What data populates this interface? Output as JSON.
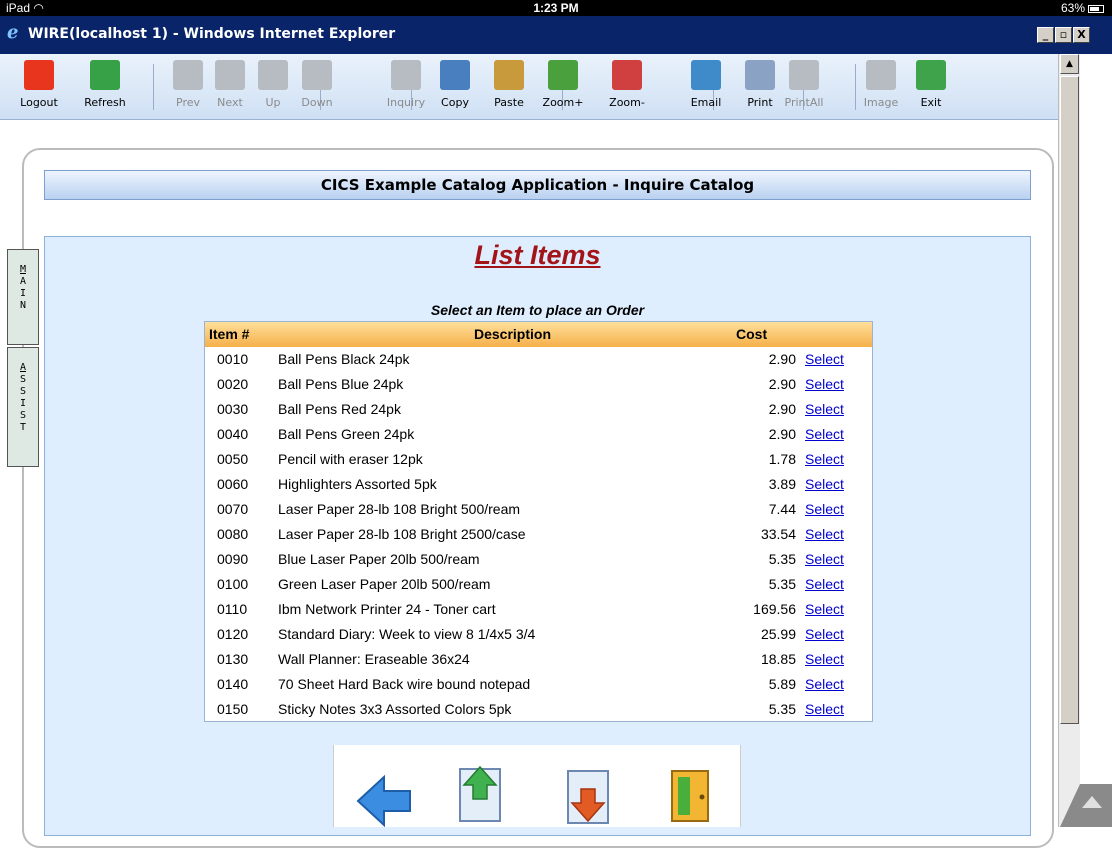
{
  "status_bar": {
    "device": "iPad",
    "wifi": "◠",
    "time": "1:23 PM",
    "battery": "63%"
  },
  "window": {
    "title": "WIRE(localhost 1) - Windows Internet Explorer",
    "min": "_",
    "max": "▫",
    "close": "X"
  },
  "toolbar": {
    "buttons": [
      {
        "label": "Logout",
        "icon": "logout-icon",
        "color": "#e8361e",
        "enabled": true
      },
      {
        "label": "Refresh",
        "icon": "refresh-icon",
        "color": "#36a146",
        "enabled": true
      },
      {
        "label": "Prev",
        "icon": "arrow-left-icon",
        "color": "#b7bcc3",
        "enabled": false
      },
      {
        "label": "Next",
        "icon": "arrow-right-icon",
        "color": "#b7bcc3",
        "enabled": false
      },
      {
        "label": "Up",
        "icon": "arrow-up-icon",
        "color": "#b7bcc3",
        "enabled": false
      },
      {
        "label": "Down",
        "icon": "arrow-down-icon",
        "color": "#b7bcc3",
        "enabled": false
      },
      {
        "label": "Inquiry",
        "icon": "inquiry-icon",
        "color": "#b7bcc3",
        "enabled": false
      },
      {
        "label": "Copy",
        "icon": "copy-icon",
        "color": "#4a7fbf",
        "enabled": true
      },
      {
        "label": "Paste",
        "icon": "paste-icon",
        "color": "#c89a3c",
        "enabled": true
      },
      {
        "label": "Zoom+",
        "icon": "zoom-in-icon",
        "color": "#4aa03c",
        "enabled": true
      },
      {
        "label": "Zoom-",
        "icon": "zoom-out-icon",
        "color": "#d04040",
        "enabled": true
      },
      {
        "label": "Email",
        "icon": "email-icon",
        "color": "#3f8ac9",
        "enabled": true
      },
      {
        "label": "Print",
        "icon": "print-icon",
        "color": "#8aa3c4",
        "enabled": true
      },
      {
        "label": "PrintAll",
        "icon": "print-all-icon",
        "color": "#b7bcc3",
        "enabled": false
      },
      {
        "label": "Image",
        "icon": "image-icon",
        "color": "#b7bcc3",
        "enabled": false
      },
      {
        "label": "Exit",
        "icon": "exit-icon",
        "color": "#3ea34a",
        "enabled": true
      }
    ]
  },
  "page": {
    "header": "CICS Example Catalog Application - Inquire Catalog",
    "title": "List Items",
    "subtitle": "Select an Item to place an Order"
  },
  "table": {
    "columns": {
      "item": "Item #",
      "description": "Description",
      "cost": "Cost"
    },
    "rows": [
      {
        "item": "0010",
        "description": "Ball Pens Black 24pk",
        "cost": "2.90",
        "action": "Select"
      },
      {
        "item": "0020",
        "description": "Ball Pens Blue 24pk",
        "cost": "2.90",
        "action": "Select"
      },
      {
        "item": "0030",
        "description": "Ball Pens Red 24pk",
        "cost": "2.90",
        "action": "Select"
      },
      {
        "item": "0040",
        "description": "Ball Pens Green 24pk",
        "cost": "2.90",
        "action": "Select"
      },
      {
        "item": "0050",
        "description": "Pencil with eraser 12pk",
        "cost": "1.78",
        "action": "Select"
      },
      {
        "item": "0060",
        "description": "Highlighters Assorted 5pk",
        "cost": "3.89",
        "action": "Select"
      },
      {
        "item": "0070",
        "description": "Laser Paper 28-lb 108 Bright 500/ream",
        "cost": "7.44",
        "action": "Select"
      },
      {
        "item": "0080",
        "description": "Laser Paper 28-lb 108 Bright 2500/case",
        "cost": "33.54",
        "action": "Select"
      },
      {
        "item": "0090",
        "description": "Blue Laser Paper 20lb 500/ream",
        "cost": "5.35",
        "action": "Select"
      },
      {
        "item": "0100",
        "description": "Green Laser Paper 20lb 500/ream",
        "cost": "5.35",
        "action": "Select"
      },
      {
        "item": "0110",
        "description": "Ibm Network Printer 24 - Toner cart",
        "cost": "169.56",
        "action": "Select"
      },
      {
        "item": "0120",
        "description": "Standard Diary: Week to view 8 1/4x5 3/4",
        "cost": "25.99",
        "action": "Select"
      },
      {
        "item": "0130",
        "description": "Wall Planner: Eraseable 36x24",
        "cost": "18.85",
        "action": "Select"
      },
      {
        "item": "0140",
        "description": "70 Sheet Hard Back wire bound notepad",
        "cost": "5.89",
        "action": "Select"
      },
      {
        "item": "0150",
        "description": "Sticky Notes 3x3 Assorted Colors 5pk",
        "cost": "5.35",
        "action": "Select"
      }
    ]
  },
  "side_tabs": [
    {
      "letters": [
        "M",
        "A",
        "I",
        "N"
      ]
    },
    {
      "letters": [
        "A",
        "S",
        "S",
        "I",
        "S",
        "T"
      ]
    }
  ],
  "nav_icons": [
    "back-arrow-icon",
    "page-up-icon",
    "page-down-icon",
    "exit-door-icon"
  ],
  "colors": {
    "accent_red": "#a31418",
    "link": "#0000cc",
    "title_bar": "#0a246a",
    "table_header": "#f5b04a",
    "panel": "#dfeeff"
  }
}
